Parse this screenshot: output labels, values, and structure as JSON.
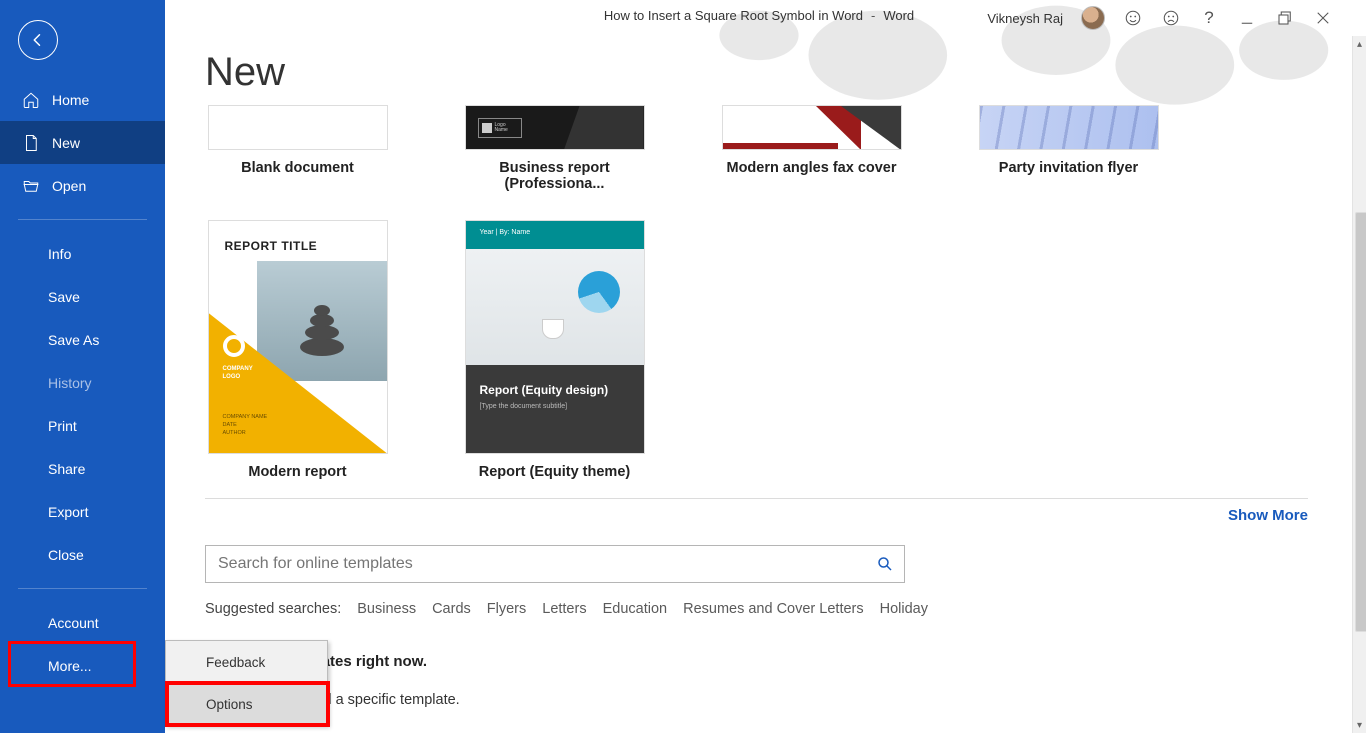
{
  "window": {
    "doc_title": "How to Insert a Square Root Symbol in Word",
    "sep": "-",
    "app_name": "Word",
    "user_name": "Vikneysh Raj"
  },
  "sidebar": {
    "home": "Home",
    "new": "New",
    "open": "Open",
    "info": "Info",
    "save": "Save",
    "save_as": "Save As",
    "history": "History",
    "print": "Print",
    "share": "Share",
    "export": "Export",
    "close": "Close",
    "account": "Account",
    "more": "More..."
  },
  "popup": {
    "feedback": "Feedback",
    "options": "Options"
  },
  "page": {
    "title": "New",
    "templates": {
      "blank": "Blank document",
      "biz": "Business report (Professiona...",
      "fax": "Modern angles fax cover",
      "party": "Party invitation flyer",
      "modern": "Modern report",
      "equity": "Report (Equity theme)"
    },
    "modern_thumb": {
      "title": "REPORT TITLE",
      "logolabel": "COMPANY\nLOGO",
      "small": "COMPANY NAME\nDATE\nAUTHOR"
    },
    "equity_thumb": {
      "head": "Year | By: Name",
      "t1": "Report (Equity design)",
      "t2": "[Type the document subtitle]"
    },
    "show_more": "Show More",
    "search_placeholder": "Search for online templates",
    "suggested_label": "Suggested searches:",
    "suggested": {
      "s0": "Business",
      "s1": "Cards",
      "s2": "Flyers",
      "s3": "Letters",
      "s4": "Education",
      "s5": "Resumes and Cover Letters",
      "s6": "Holiday"
    },
    "msg1_suffix": " any Office templates right now.",
    "msg2_suffix": "e search box to find a specific template."
  }
}
